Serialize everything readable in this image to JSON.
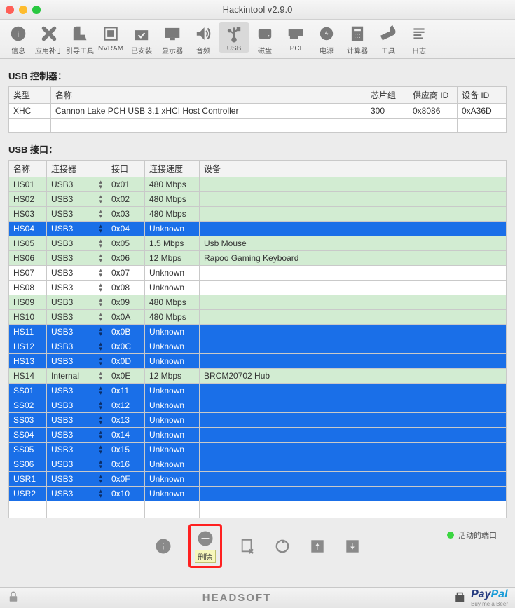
{
  "window": {
    "title": "Hackintool v2.9.0"
  },
  "toolbar": {
    "items": [
      {
        "name": "info",
        "label": "信息"
      },
      {
        "name": "patch",
        "label": "应用补丁"
      },
      {
        "name": "boot",
        "label": "引导工具"
      },
      {
        "name": "nvram",
        "label": "NVRAM"
      },
      {
        "name": "installed",
        "label": "已安装"
      },
      {
        "name": "display",
        "label": "显示器"
      },
      {
        "name": "audio",
        "label": "音频"
      },
      {
        "name": "usb",
        "label": "USB"
      },
      {
        "name": "disk",
        "label": "磁盘"
      },
      {
        "name": "pci",
        "label": "PCI"
      },
      {
        "name": "power",
        "label": "电源"
      },
      {
        "name": "calc",
        "label": "计算器"
      },
      {
        "name": "tools",
        "label": "工具"
      },
      {
        "name": "logs",
        "label": "日志"
      }
    ]
  },
  "usb_controllers": {
    "title": "USB 控制器：",
    "headers": {
      "type": "类型",
      "name": "名称",
      "chipset": "芯片组",
      "vendor": "供应商 ID",
      "device": "设备 ID"
    },
    "rows": [
      {
        "type": "XHC",
        "name": "Cannon Lake PCH USB 3.1 xHCI Host Controller",
        "chipset": "300",
        "vendor": "0x8086",
        "device": "0xA36D"
      }
    ]
  },
  "usb_ports": {
    "title": "USB 接口：",
    "headers": {
      "name": "名称",
      "connector": "连接器",
      "port": "接口",
      "speed": "连接速度",
      "device": "设备"
    },
    "rows": [
      {
        "name": "HS01",
        "connector": "USB3",
        "port": "0x01",
        "speed": "480 Mbps",
        "device": "",
        "cls": "green"
      },
      {
        "name": "HS02",
        "connector": "USB3",
        "port": "0x02",
        "speed": "480 Mbps",
        "device": "",
        "cls": "green"
      },
      {
        "name": "HS03",
        "connector": "USB3",
        "port": "0x03",
        "speed": "480 Mbps",
        "device": "",
        "cls": "green"
      },
      {
        "name": "HS04",
        "connector": "USB3",
        "port": "0x04",
        "speed": "Unknown",
        "device": "",
        "cls": "blue"
      },
      {
        "name": "HS05",
        "connector": "USB3",
        "port": "0x05",
        "speed": "1.5 Mbps",
        "device": "Usb Mouse",
        "cls": "green"
      },
      {
        "name": "HS06",
        "connector": "USB3",
        "port": "0x06",
        "speed": "12 Mbps",
        "device": "Rapoo Gaming Keyboard",
        "cls": "green"
      },
      {
        "name": "HS07",
        "connector": "USB3",
        "port": "0x07",
        "speed": "Unknown",
        "device": "",
        "cls": "white"
      },
      {
        "name": "HS08",
        "connector": "USB3",
        "port": "0x08",
        "speed": "Unknown",
        "device": "",
        "cls": "white"
      },
      {
        "name": "HS09",
        "connector": "USB3",
        "port": "0x09",
        "speed": "480 Mbps",
        "device": "",
        "cls": "green"
      },
      {
        "name": "HS10",
        "connector": "USB3",
        "port": "0x0A",
        "speed": "480 Mbps",
        "device": "",
        "cls": "green"
      },
      {
        "name": "HS11",
        "connector": "USB3",
        "port": "0x0B",
        "speed": "Unknown",
        "device": "",
        "cls": "blue"
      },
      {
        "name": "HS12",
        "connector": "USB3",
        "port": "0x0C",
        "speed": "Unknown",
        "device": "",
        "cls": "blue"
      },
      {
        "name": "HS13",
        "connector": "USB3",
        "port": "0x0D",
        "speed": "Unknown",
        "device": "",
        "cls": "blue"
      },
      {
        "name": "HS14",
        "connector": "Internal",
        "port": "0x0E",
        "speed": "12 Mbps",
        "device": "BRCM20702 Hub",
        "cls": "green"
      },
      {
        "name": "SS01",
        "connector": "USB3",
        "port": "0x11",
        "speed": "Unknown",
        "device": "",
        "cls": "blue"
      },
      {
        "name": "SS02",
        "connector": "USB3",
        "port": "0x12",
        "speed": "Unknown",
        "device": "",
        "cls": "blue"
      },
      {
        "name": "SS03",
        "connector": "USB3",
        "port": "0x13",
        "speed": "Unknown",
        "device": "",
        "cls": "blue"
      },
      {
        "name": "SS04",
        "connector": "USB3",
        "port": "0x14",
        "speed": "Unknown",
        "device": "",
        "cls": "blue"
      },
      {
        "name": "SS05",
        "connector": "USB3",
        "port": "0x15",
        "speed": "Unknown",
        "device": "",
        "cls": "blue"
      },
      {
        "name": "SS06",
        "connector": "USB3",
        "port": "0x16",
        "speed": "Unknown",
        "device": "",
        "cls": "blue"
      },
      {
        "name": "USR1",
        "connector": "USB3",
        "port": "0x0F",
        "speed": "Unknown",
        "device": "",
        "cls": "blue"
      },
      {
        "name": "USR2",
        "connector": "USB3",
        "port": "0x10",
        "speed": "Unknown",
        "device": "",
        "cls": "blue"
      }
    ]
  },
  "bottom": {
    "delete_tooltip": "删除",
    "active_port_label": "活动的端口"
  },
  "footer": {
    "brand": "HEADSOFT",
    "paypal_pay": "Pay",
    "paypal_pal": "Pal",
    "paypal_sub": "Buy me a Beer"
  }
}
